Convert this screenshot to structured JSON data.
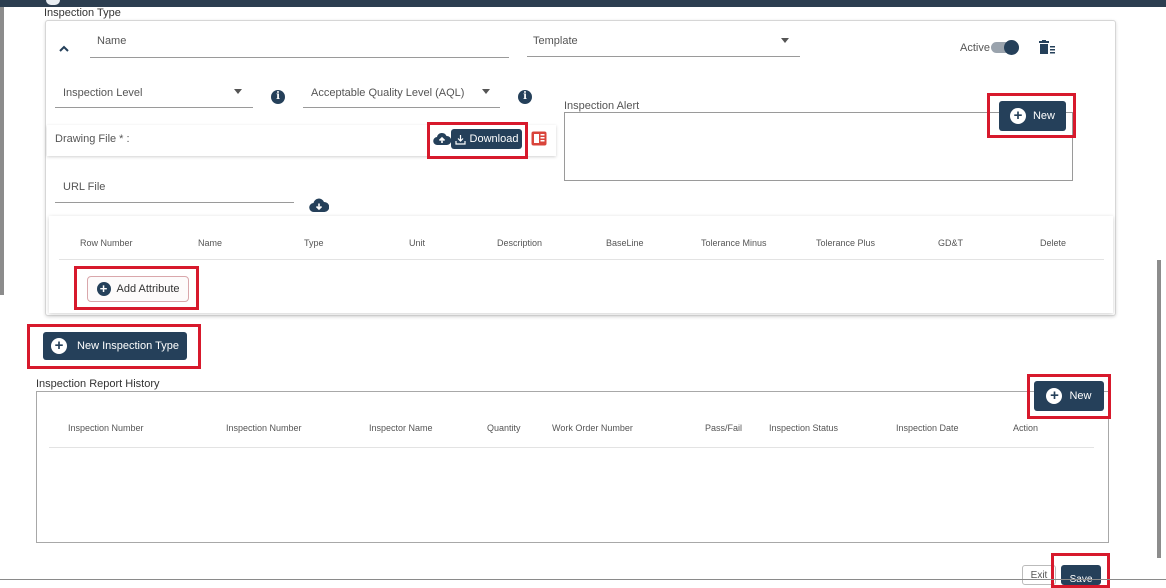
{
  "inspection_type": {
    "section_label": "Inspection Type",
    "name_placeholder": "Name",
    "template_label": "Template",
    "active_label": "Active",
    "inspection_level_label": "Inspection Level",
    "aql_label": "Acceptable Quality Level (AQL)",
    "drawing_file_label": "Drawing File * :",
    "download_label": "Download",
    "url_file_label": "URL File",
    "inspection_alert_label": "Inspection Alert",
    "new_label": "New",
    "attribute_columns": [
      "Row Number",
      "Name",
      "Type",
      "Unit",
      "Description",
      "BaseLine",
      "Tolerance Minus",
      "Tolerance Plus",
      "GD&T",
      "Delete"
    ],
    "add_attribute_label": "Add Attribute"
  },
  "new_inspection_type_label": "New Inspection Type",
  "report_history": {
    "section_label": "Inspection Report History",
    "new_label": "New",
    "columns": [
      "Inspection Number",
      "Inspection Number",
      "Inspector Name",
      "Quantity",
      "Work Order Number",
      "Pass/Fail",
      "Inspection Status",
      "Inspection Date",
      "Action"
    ]
  },
  "footer": {
    "exit_label": "Exit",
    "save_label": "Save"
  },
  "colors": {
    "primary": "#25405a",
    "highlight": "#d7192c",
    "pdf_icon": "#d9443b"
  }
}
